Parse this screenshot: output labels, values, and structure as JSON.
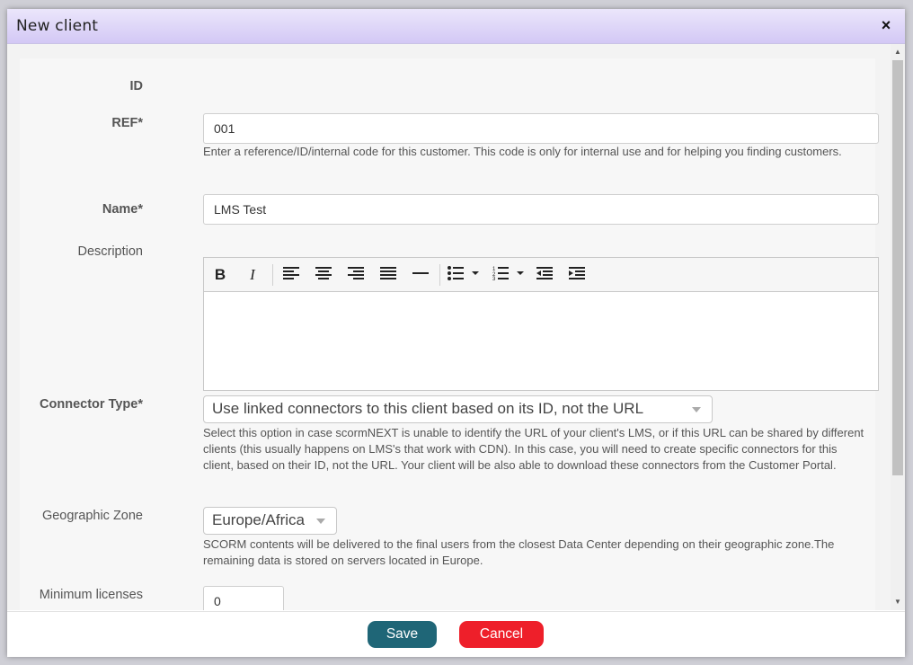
{
  "dialog": {
    "title": "New client",
    "close_icon": "×"
  },
  "form": {
    "id_label": "ID",
    "ref_label": "REF*",
    "ref_value": "001",
    "ref_help": "Enter a reference/ID/internal code for this customer. This code is only for internal use and for helping you finding customers.",
    "name_label": "Name*",
    "name_value": "LMS Test",
    "description_label": "Description",
    "connector_label": "Connector Type*",
    "connector_value": "Use linked connectors to this client based on its ID, not the URL",
    "connector_help": "Select this option in case scormNEXT is unable to identify the URL of your client's LMS, or if this URL can be shared by different clients (this usually happens on LMS's that work with CDN). In this case, you will need to create specific connectors for this client, based on their ID, not the URL. Your client will be also able to download these connectors from the Customer Portal.",
    "geo_label": "Geographic Zone",
    "geo_value": "Europe/Africa",
    "geo_help": "SCORM contents will be delivered to the final users from the closest Data Center depending on their geographic zone.The remaining data is stored on servers located in Europe.",
    "min_label": "Minimum licenses",
    "min_value": "0"
  },
  "toolbar": {
    "icons": [
      "bold-icon",
      "italic-icon",
      "align-left-icon",
      "align-center-icon",
      "align-right-icon",
      "align-justify-icon",
      "horizontal-rule-icon",
      "bullet-list-icon",
      "numbered-list-icon",
      "outdent-icon",
      "indent-icon"
    ]
  },
  "footer": {
    "save_label": "Save",
    "cancel_label": "Cancel"
  },
  "colors": {
    "save": "#1f6677",
    "cancel": "#ee1f2a",
    "titlebar": "#d3c8f5"
  }
}
